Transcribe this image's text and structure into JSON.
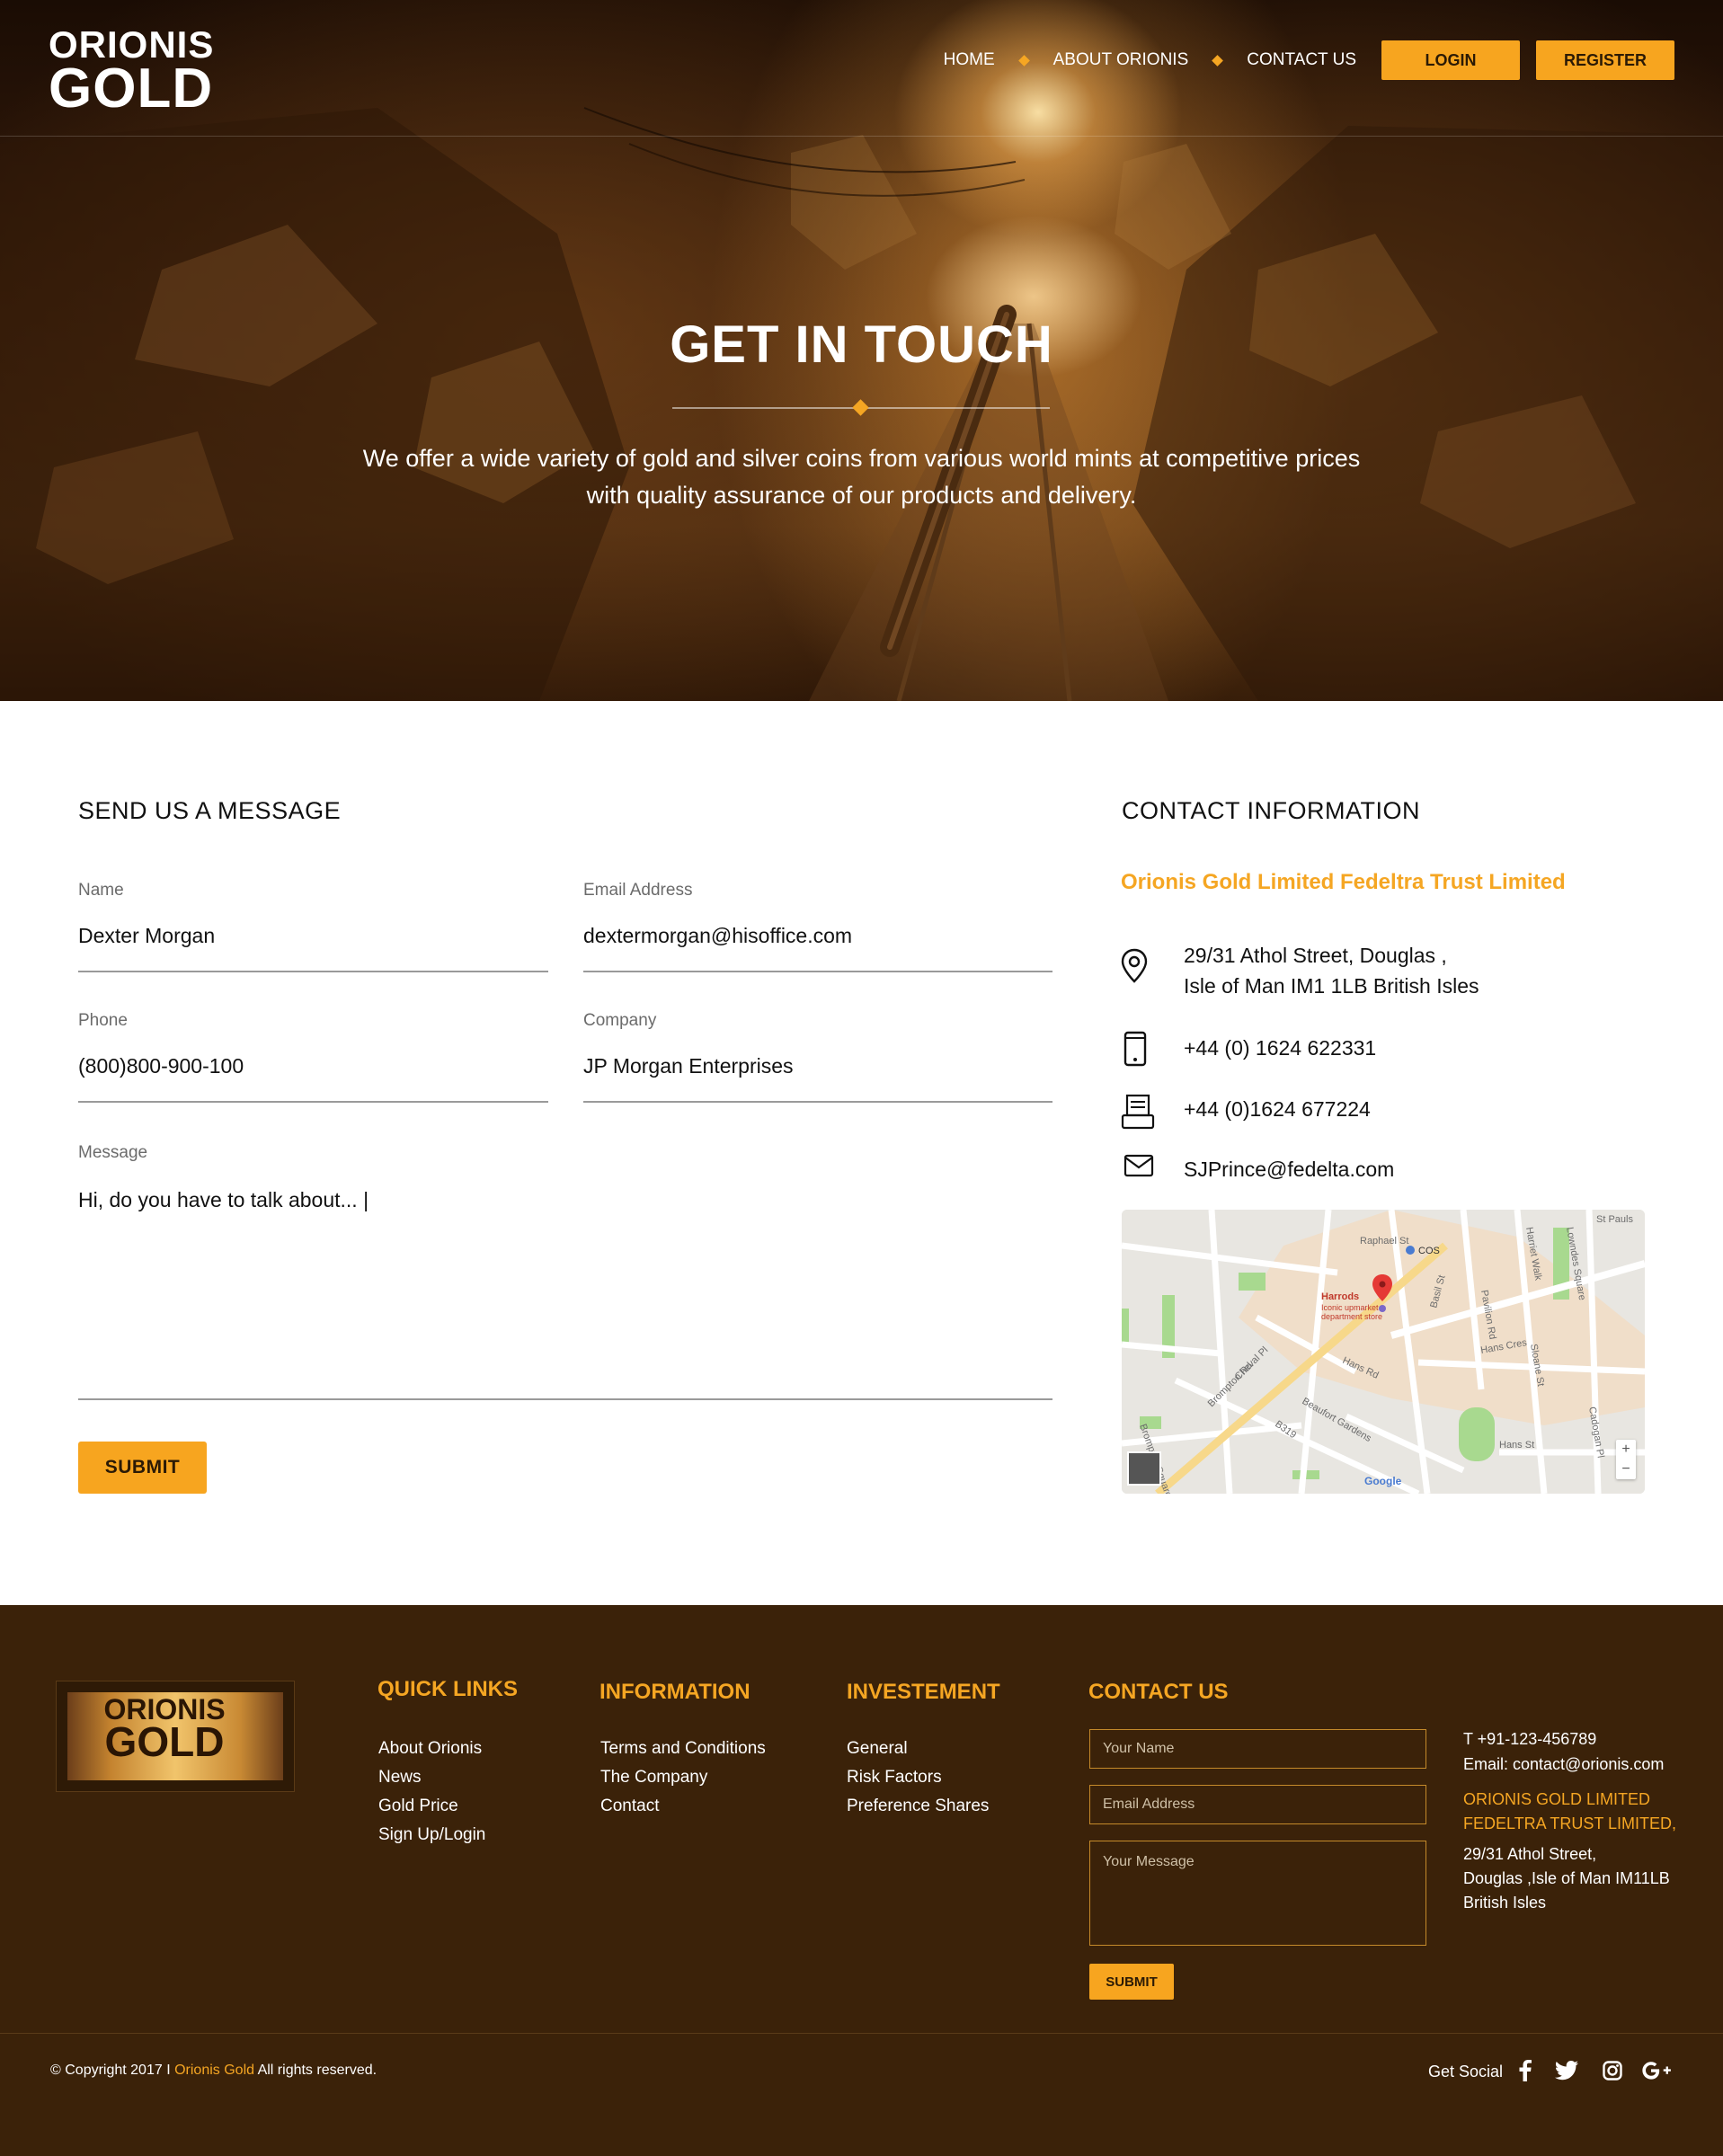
{
  "header": {
    "logo_line1": "ORIONIS",
    "logo_line2": "GOLD",
    "nav": [
      "HOME",
      "ABOUT ORIONIS",
      "CONTACT US"
    ],
    "login": "LOGIN",
    "register": "REGISTER"
  },
  "hero": {
    "title": "GET IN TOUCH",
    "subtitle": "We offer a wide variety of gold and silver coins from various world mints at competitive prices with quality assurance of our products and delivery."
  },
  "form": {
    "title": "SEND US A MESSAGE",
    "name_label": "Name",
    "name_value": "Dexter Morgan",
    "email_label": "Email Address",
    "email_value": "dextermorgan@hisoffice.com",
    "phone_label": "Phone",
    "phone_value": "(800)800-900-100",
    "company_label": "Company",
    "company_value": "JP Morgan Enterprises",
    "message_label": "Message",
    "message_value": "Hi, do you have to talk about...  |",
    "submit": "SUBMIT"
  },
  "contact_info": {
    "title": "CONTACT INFORMATION",
    "company": "Orionis Gold Limited Fedeltra Trust Limited",
    "address_line1": "29/31 Athol Street, Douglas ,",
    "address_line2": "Isle of Man IM1 1LB British Isles",
    "phone": "+44 (0) 1624 622331",
    "fax": "+44 (0)1624 677224",
    "email": "SJPrince@fedelta.com",
    "icons": [
      "location-pin-icon",
      "mobile-phone-icon",
      "fax-icon",
      "envelope-icon"
    ]
  },
  "map": {
    "labels": [
      "Raphael St",
      "COS",
      "Harrods",
      "Iconic upmarket",
      "department store",
      "Brompton Rd",
      "Hans Rd",
      "Basil St",
      "Pavilion Rd",
      "Sloane St",
      "Hans Cres",
      "Beaufort Gardens",
      "Cheval Pl",
      "Brompton Square",
      "B319",
      "Hans St",
      "Cadogan Pl",
      "Lowndes Square",
      "Harriet Walk",
      "St Pauls",
      "Google"
    ],
    "zoom_in": "+",
    "zoom_out": "−"
  },
  "footer": {
    "logo_line1": "ORIONIS",
    "logo_line2": "GOLD",
    "quick_links_title": "QUICK LINKS",
    "quick_links": [
      "About Orionis",
      "News",
      "Gold Price",
      "Sign Up/Login"
    ],
    "information_title": "INFORMATION",
    "information": [
      "Terms and Conditions",
      "The Company",
      "Contact"
    ],
    "investment_title": "INVESTEMENT",
    "investment": [
      "General",
      "Risk Factors",
      "Preference Shares"
    ],
    "contact_title": "CONTACT US",
    "name_placeholder": "Your Name",
    "email_placeholder": "Email Address",
    "message_placeholder": "Your Message",
    "submit": "SUBMIT",
    "phone": "T +91-123-456789",
    "email": "Email: contact@orionis.com",
    "company_line1": "ORIONIS GOLD LIMITED",
    "company_line2": "FEDELTRA TRUST LIMITED,",
    "address_line1": "29/31 Athol Street,",
    "address_line2": "Douglas ,Isle of Man IM11LB",
    "address_line3": "British Isles",
    "copyright_prefix": "© Copyright 2017 I",
    "copyright_brand": "Orionis Gold",
    "copyright_suffix": "All rights reserved.",
    "get_social": "Get Social",
    "social_icons": [
      "facebook-icon",
      "twitter-icon",
      "instagram-icon",
      "google-plus-icon"
    ]
  },
  "colors": {
    "accent": "#f7a51f",
    "footer_bg": "#3b2209",
    "hero_dark": "#2a1506"
  }
}
